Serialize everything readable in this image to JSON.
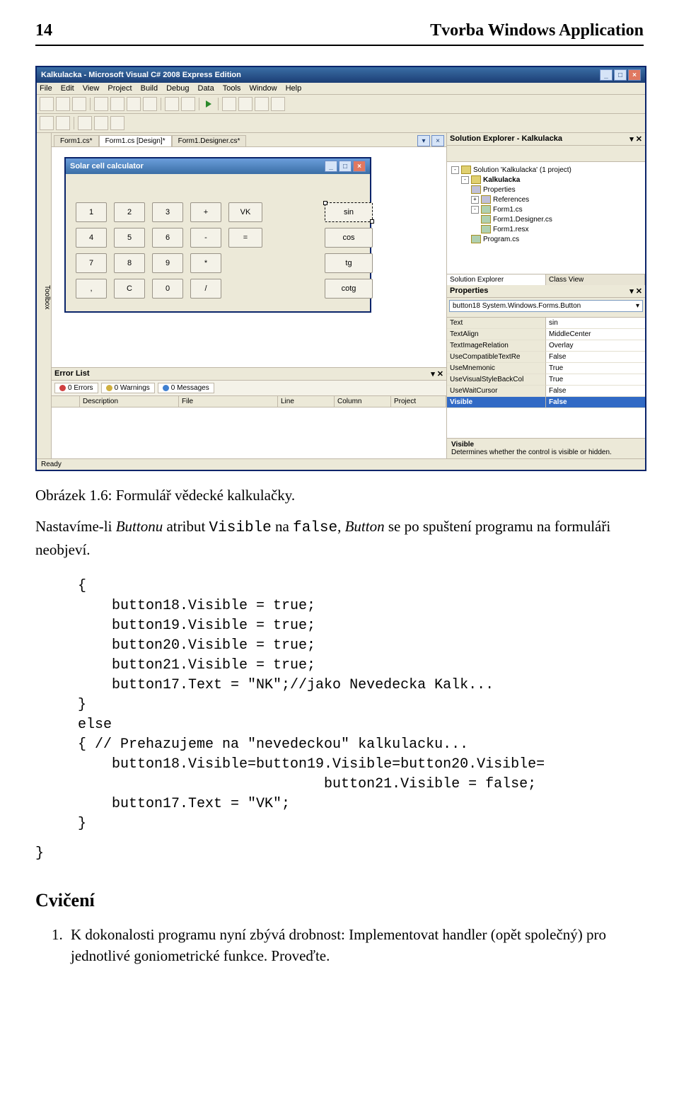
{
  "header": {
    "page_number": "14",
    "title": "Tvorba Windows Application"
  },
  "screenshot": {
    "app_title": "Kalkulacka - Microsoft Visual C# 2008 Express Edition",
    "menus": [
      "File",
      "Edit",
      "View",
      "Project",
      "Build",
      "Debug",
      "Data",
      "Tools",
      "Window",
      "Help"
    ],
    "tabs": [
      "Form1.cs*",
      "Form1.cs [Design]*",
      "Form1.Designer.cs*"
    ],
    "left_toolbox": "Toolbox",
    "designer_window_title": "Solar cell calculator",
    "calc_buttons": {
      "r1": [
        "1",
        "2",
        "3",
        "+",
        "VK",
        "",
        "sin"
      ],
      "r2": [
        "4",
        "5",
        "6",
        "-",
        "=",
        "",
        "cos"
      ],
      "r3": [
        "7",
        "8",
        "9",
        "*",
        "",
        "",
        "tg"
      ],
      "r4": [
        ",",
        "C",
        "0",
        "/",
        "",
        "",
        "cotg"
      ]
    },
    "error_list": {
      "title": "Error List",
      "filters": [
        {
          "label": "0 Errors",
          "color": "#d04040"
        },
        {
          "label": "0 Warnings",
          "color": "#d0b040"
        },
        {
          "label": "0 Messages",
          "color": "#4080d0"
        }
      ],
      "columns": [
        "",
        "Description",
        "File",
        "Line",
        "Column",
        "Project"
      ]
    },
    "solution_explorer": {
      "title": "Solution Explorer - Kalkulacka",
      "nodes": [
        {
          "indent": 0,
          "exp": "-",
          "icon": "sol",
          "label": "Solution 'Kalkulacka' (1 project)"
        },
        {
          "indent": 1,
          "exp": "-",
          "icon": "proj",
          "label": "Kalkulacka"
        },
        {
          "indent": 2,
          "exp": "",
          "icon": "ref",
          "label": "Properties"
        },
        {
          "indent": 2,
          "exp": "+",
          "icon": "ref",
          "label": "References"
        },
        {
          "indent": 2,
          "exp": "-",
          "icon": "cs",
          "label": "Form1.cs"
        },
        {
          "indent": 3,
          "exp": "",
          "icon": "cs",
          "label": "Form1.Designer.cs"
        },
        {
          "indent": 3,
          "exp": "",
          "icon": "cs",
          "label": "Form1.resx"
        },
        {
          "indent": 2,
          "exp": "",
          "icon": "cs",
          "label": "Program.cs"
        }
      ],
      "tabs": [
        "Solution Explorer",
        "Class View"
      ]
    },
    "properties": {
      "title": "Properties",
      "object": "button18 System.Windows.Forms.Button",
      "rows": [
        {
          "k": "Text",
          "v": "sin"
        },
        {
          "k": "TextAlign",
          "v": "MiddleCenter"
        },
        {
          "k": "TextImageRelation",
          "v": "Overlay"
        },
        {
          "k": "UseCompatibleTextRe",
          "v": "False"
        },
        {
          "k": "UseMnemonic",
          "v": "True"
        },
        {
          "k": "UseVisualStyleBackCol",
          "v": "True"
        },
        {
          "k": "UseWaitCursor",
          "v": "False"
        },
        {
          "k": "Visible",
          "v": "False",
          "sel": true
        }
      ],
      "help_name": "Visible",
      "help_desc": "Determines whether the control is visible or hidden."
    },
    "status_bar": "Ready"
  },
  "figure_caption": "Obrázek 1.6: Formulář vědecké kalkulačky.",
  "paragraph1_a": "Nastavíme-li ",
  "paragraph1_b": "Buttonu",
  "paragraph1_c": " atribut ",
  "paragraph1_d": "Visible",
  "paragraph1_e": " na ",
  "paragraph1_f": "false",
  "paragraph1_g": ", ",
  "paragraph1_h": "Button",
  "paragraph1_i": " se po spuštení programu na formuláři neobjeví.",
  "code_block": "{\n    button18.Visible = true;\n    button19.Visible = true;\n    button20.Visible = true;\n    button21.Visible = true;\n    button17.Text = \"NK\";//jako Nevedecka Kalk...\n}\nelse\n{ // Prehazujeme na \"nevedeckou\" kalkulacku...\n    button18.Visible=button19.Visible=button20.Visible=\n                             button21.Visible = false;\n    button17.Text = \"VK\";\n}",
  "closing_brace": "}",
  "exercises_title": "Cvičení",
  "exercise1": "K dokonalosti programu nyní zbývá drobnost: Implementovat handler (opět společný) pro jednotlivé goniometrické funkce. Proveďte."
}
